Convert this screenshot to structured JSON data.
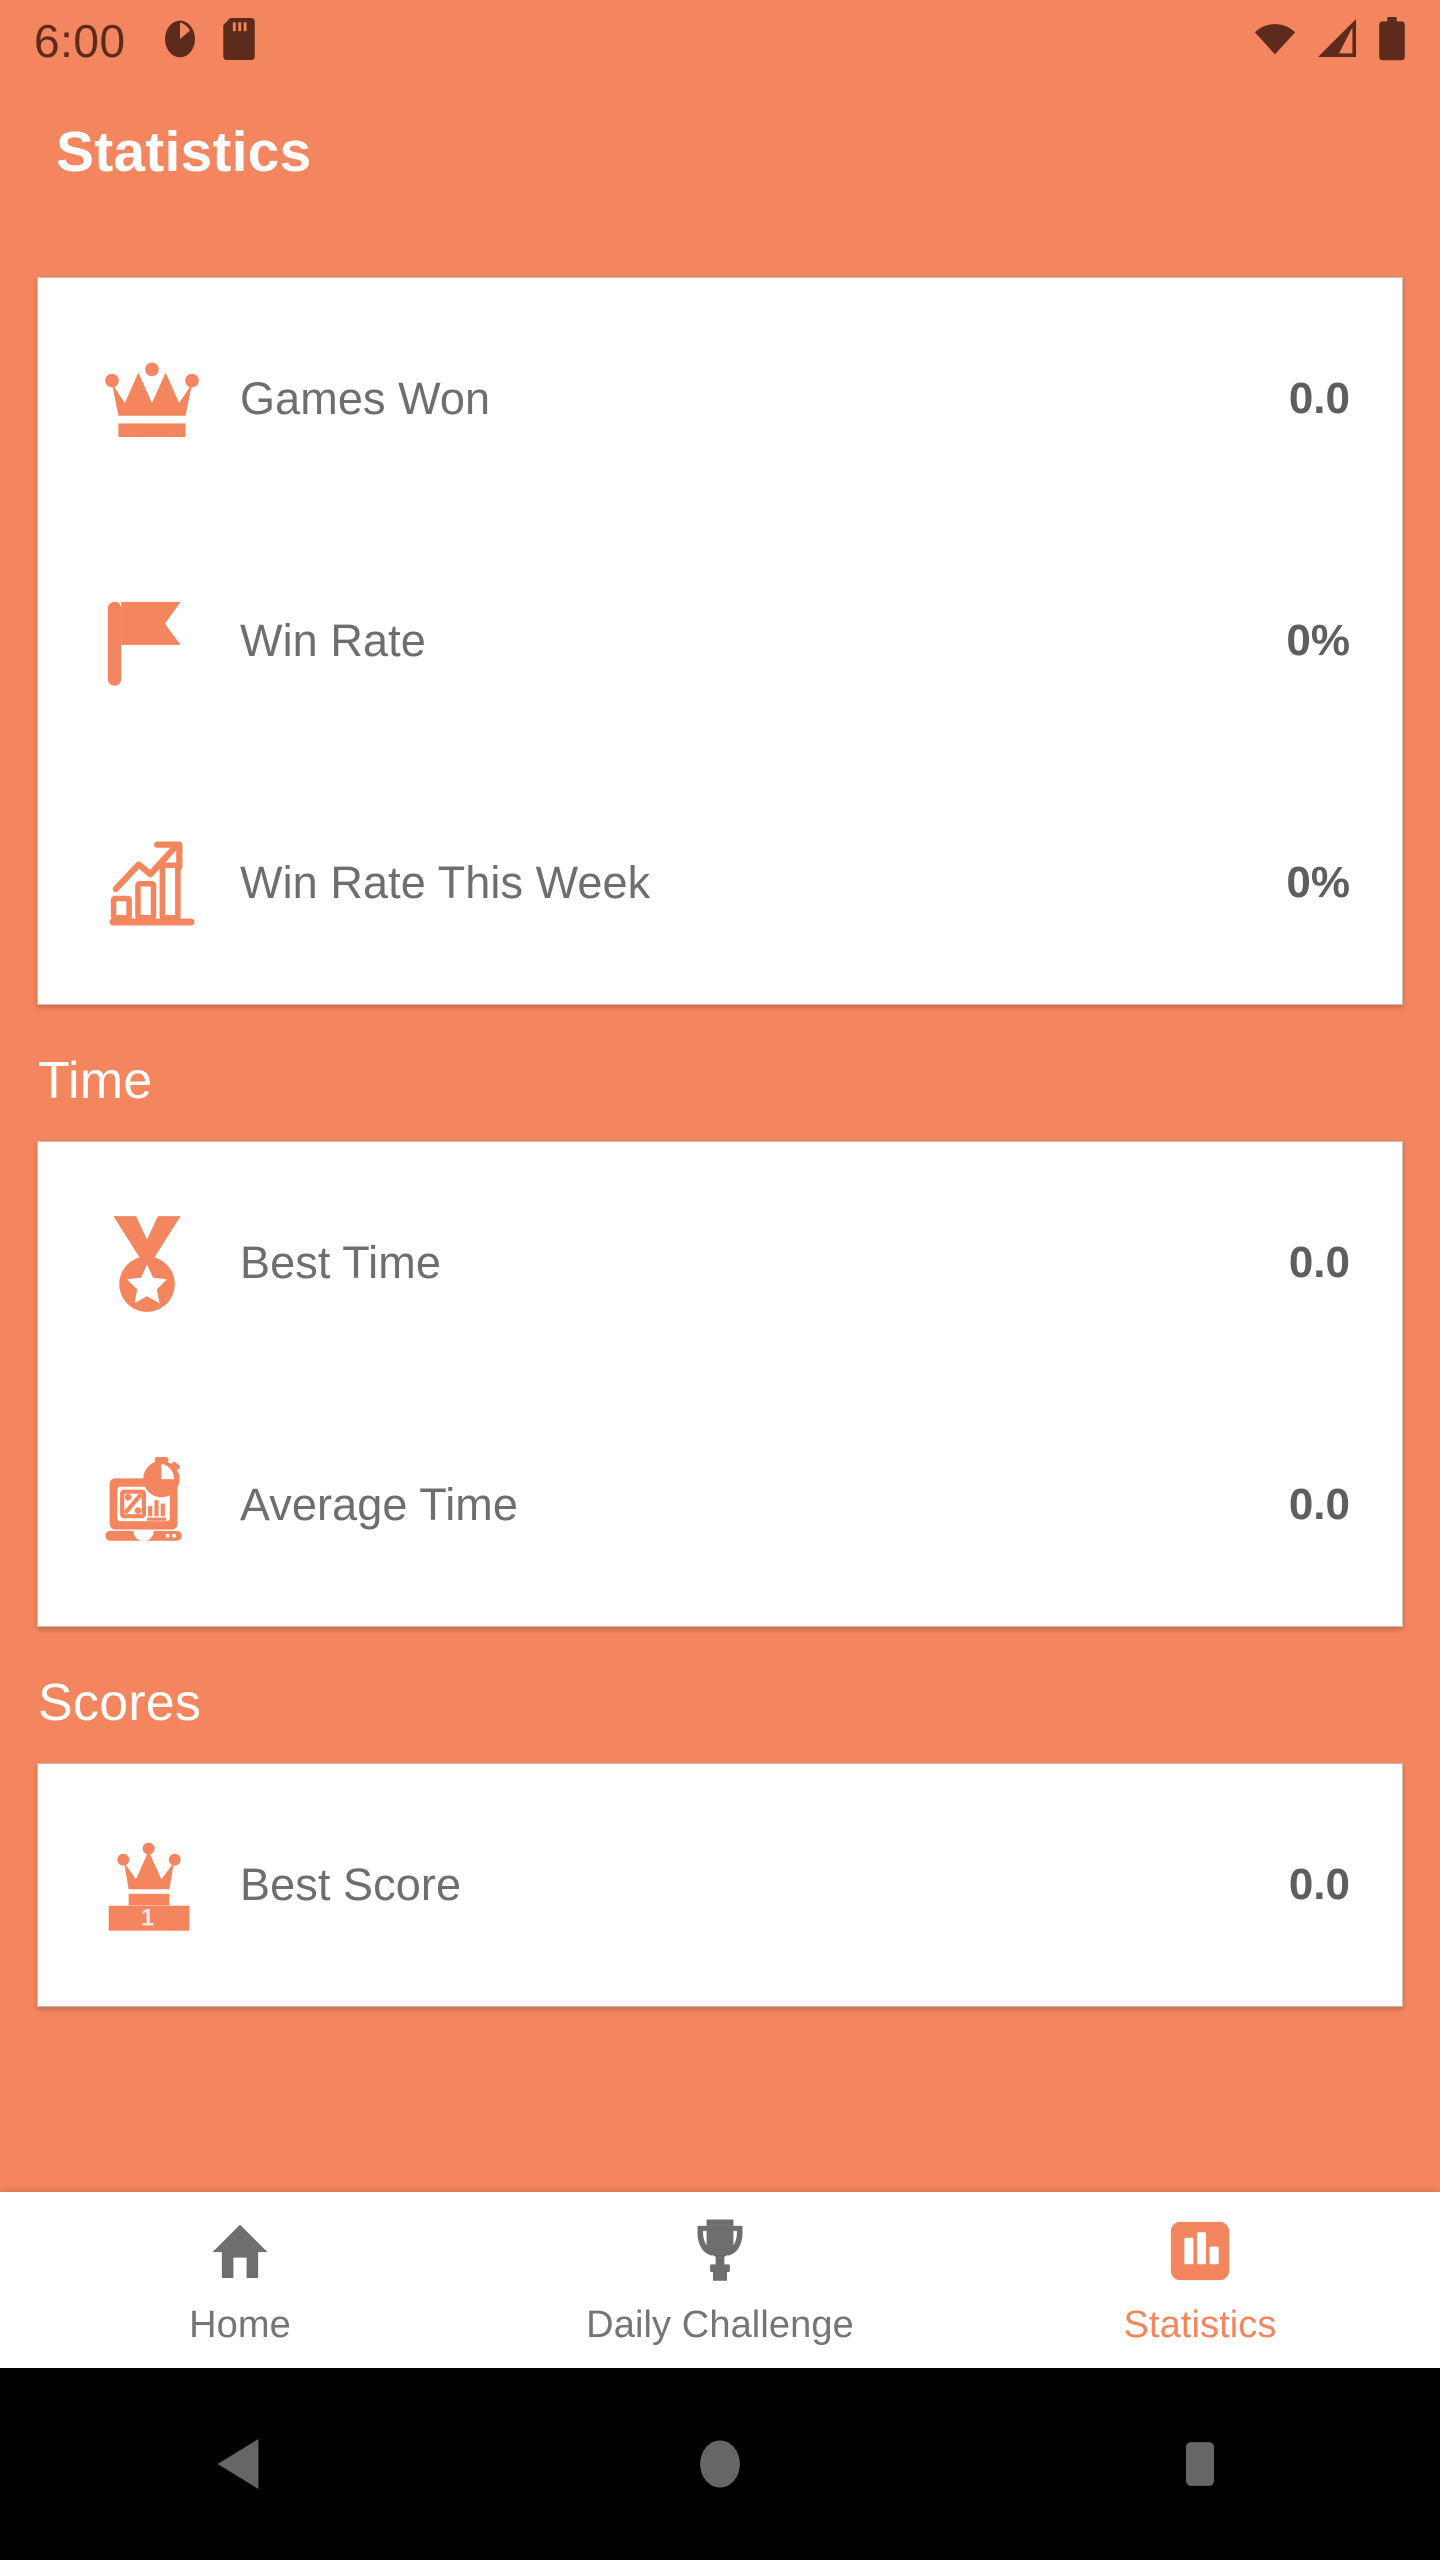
{
  "status_bar": {
    "time": "6:00",
    "left_icons": [
      "pie-chart-app-icon",
      "sd-card-icon"
    ],
    "right_icons": [
      "wifi-icon",
      "cellular-signal-icon",
      "battery-icon"
    ]
  },
  "app_bar": {
    "title": "Statistics"
  },
  "colors": {
    "accent": "#F4865F",
    "card_background": "#FFFFFF",
    "label_text": "#6E6E6E",
    "value_text": "#5E5E5E",
    "nav_inactive": "#757575",
    "status_icon": "#5C2B1C"
  },
  "sections": [
    {
      "header": null,
      "rows": [
        {
          "icon": "crown-icon",
          "label": "Games Won",
          "value": "0.0"
        },
        {
          "icon": "flag-icon",
          "label": "Win Rate",
          "value": "0%"
        },
        {
          "icon": "growth-chart-icon",
          "label": "Win Rate This Week",
          "value": "0%"
        }
      ]
    },
    {
      "header": "Time",
      "rows": [
        {
          "icon": "medal-icon",
          "label": "Best Time",
          "value": "0.0"
        },
        {
          "icon": "laptop-analytics-icon",
          "label": "Average Time",
          "value": "0.0"
        }
      ]
    },
    {
      "header": "Scores",
      "rows": [
        {
          "icon": "podium-crown-icon",
          "label": "Best Score",
          "value": "0.0"
        }
      ]
    }
  ],
  "bottom_nav": {
    "items": [
      {
        "icon": "home-icon",
        "label": "Home",
        "active": false
      },
      {
        "icon": "trophy-icon",
        "label": "Daily Challenge",
        "active": false
      },
      {
        "icon": "bar-chart-icon",
        "label": "Statistics",
        "active": true
      }
    ]
  },
  "system_nav": {
    "buttons": [
      "back-triangle-icon",
      "home-circle-icon",
      "recents-square-icon"
    ]
  }
}
